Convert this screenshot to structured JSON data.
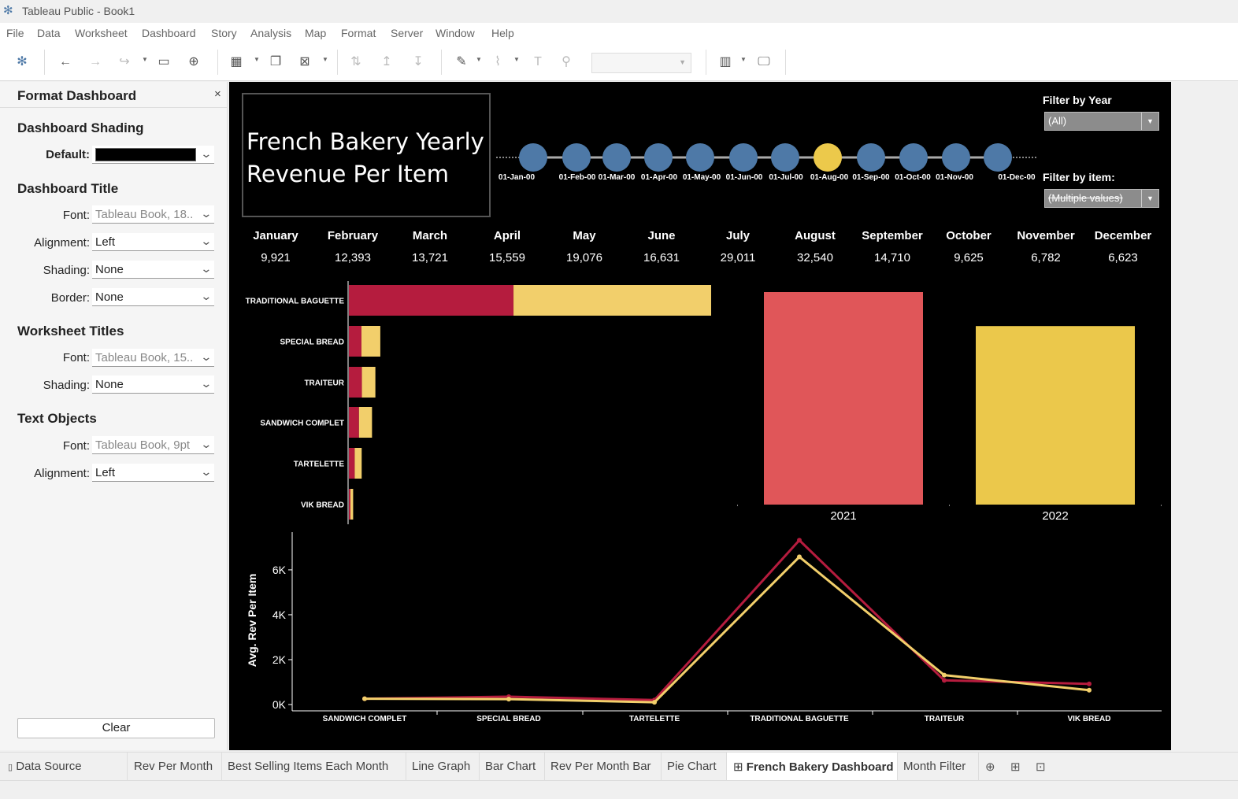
{
  "window": {
    "title": "Tableau Public - Book1"
  },
  "menu": [
    "File",
    "Data",
    "Worksheet",
    "Dashboard",
    "Story",
    "Analysis",
    "Map",
    "Format",
    "Server",
    "Window",
    "Help"
  ],
  "format_panel": {
    "title": "Format Dashboard",
    "close": "×",
    "shading": {
      "heading": "Dashboard Shading",
      "default_label": "Default:",
      "default_color": "#000000"
    },
    "dashboard_title": {
      "heading": "Dashboard Title",
      "font_label": "Font:",
      "font_value": "Tableau Book, 18..",
      "alignment_label": "Alignment:",
      "alignment_value": "Left",
      "shading_label": "Shading:",
      "shading_value": "None",
      "border_label": "Border:",
      "border_value": "None"
    },
    "worksheet_titles": {
      "heading": "Worksheet Titles",
      "font_label": "Font:",
      "font_value": "Tableau Book, 15..",
      "shading_label": "Shading:",
      "shading_value": "None"
    },
    "text_objects": {
      "heading": "Text Objects",
      "font_label": "Font:",
      "font_value": "Tableau Book, 9pt",
      "alignment_label": "Alignment:",
      "alignment_value": "Left"
    },
    "clear_label": "Clear"
  },
  "dashboard": {
    "title_line1": "French Bakery Yearly",
    "title_line2": "Revenue Per Item",
    "filter_year": {
      "label": "Filter by Year",
      "value": "(All)"
    },
    "filter_item": {
      "label": "Filter by item:",
      "value": "(Multiple values)"
    },
    "colors": {
      "background": "#000000",
      "year_2021": "#b51c3e",
      "year_2022": "#f2cf6b",
      "bar_2021": "#e05659",
      "bar_2022": "#ebc84b",
      "timeline_dot": "#4e79a7",
      "timeline_selected": "#ecc94b"
    },
    "timeline": {
      "labels": [
        "01-Jan-00",
        "01-Feb-00",
        "01-Mar-00",
        "01-Apr-00",
        "01-May-00",
        "01-Jun-00",
        "01-Jul-00",
        "01-Aug-00",
        "01-Sep-00",
        "01-Oct-00",
        "01-Nov-00",
        "01-Dec-00"
      ],
      "selected": "01-Aug-00"
    },
    "months": [
      {
        "name": "January",
        "value": "9,921"
      },
      {
        "name": "February",
        "value": "12,393"
      },
      {
        "name": "March",
        "value": "13,721"
      },
      {
        "name": "April",
        "value": "15,559"
      },
      {
        "name": "May",
        "value": "19,076"
      },
      {
        "name": "June",
        "value": "16,631"
      },
      {
        "name": "July",
        "value": "29,011"
      },
      {
        "name": "August",
        "value": "32,540"
      },
      {
        "name": "September",
        "value": "14,710"
      },
      {
        "name": "October",
        "value": "9,625"
      },
      {
        "name": "November",
        "value": "6,782"
      },
      {
        "name": "December",
        "value": "6,623"
      }
    ]
  },
  "chart_data": [
    {
      "type": "bar",
      "orientation": "horizontal",
      "stacked": true,
      "categories": [
        "TRADITIONAL BAGUETTE",
        "SPECIAL BREAD",
        "TRAITEUR",
        "SANDWICH COMPLET",
        "TARTELETTE",
        "VIK BREAD"
      ],
      "series": [
        {
          "values": [
            7330,
            560,
            580,
            450,
            260,
            70
          ],
          "color": "#b51c3e"
        },
        {
          "values": [
            8800,
            840,
            600,
            580,
            310,
            120
          ],
          "color": "#f2cf6b"
        }
      ],
      "xlim": [
        0,
        16200
      ]
    },
    {
      "type": "bar",
      "categories": [
        "2021",
        "2022"
      ],
      "values": [
        100,
        84
      ],
      "colors": [
        "#e05659",
        "#ebc84b"
      ],
      "ylim": [
        0,
        100
      ]
    },
    {
      "type": "line",
      "categories": [
        "SANDWICH COMPLET",
        "SPECIAL BREAD",
        "TARTELETTE",
        "TRADITIONAL BAGUETTE",
        "TRAITEUR",
        "VIK BREAD"
      ],
      "ylabel": "Avg. Rev Per Item",
      "yticks": [
        "0K",
        "2K",
        "4K",
        "6K"
      ],
      "ylim": [
        0,
        7400
      ],
      "series": [
        {
          "values": [
            260,
            350,
            200,
            7320,
            1080,
            920
          ],
          "color": "#b51c3e"
        },
        {
          "values": [
            260,
            240,
            100,
            6580,
            1310,
            640
          ],
          "color": "#f2cf6b"
        }
      ]
    }
  ],
  "tabs": [
    "Data Source",
    "Rev Per Month",
    "Best Selling Items Each Month",
    "Line Graph",
    "Bar Chart",
    "Rev Per Month Bar",
    "Pie Chart",
    "French Bakery Dashboard",
    "Month Filter"
  ],
  "active_tab": "French Bakery Dashboard"
}
